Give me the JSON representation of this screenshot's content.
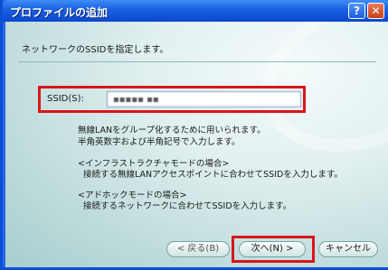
{
  "window": {
    "title": "プロファイルの追加",
    "help_label": "?",
    "close_label": "✕"
  },
  "heading": "ネットワークのSSIDを指定します。",
  "ssid": {
    "label": "SSID(S):",
    "value": "▪▪▪▪▪ ▪▪"
  },
  "description": {
    "lines": [
      "無線LANをグループ化するために用いられます。",
      "半角英数字および半角記号で入力します。",
      "<インフラストラクチャモードの場合>",
      "接続する無線LANアクセスポイントに合わせてSSIDを入力します。",
      "<アドホックモードの場合>",
      "接続するネットワークに合わせてSSIDを入力します。"
    ]
  },
  "buttons": {
    "back": "< 戻る(B)",
    "next": "次へ(N) >",
    "cancel": "キャンセル"
  },
  "colors": {
    "highlight_frame": "#d9151b",
    "titlebar": "#1a5fe0"
  }
}
